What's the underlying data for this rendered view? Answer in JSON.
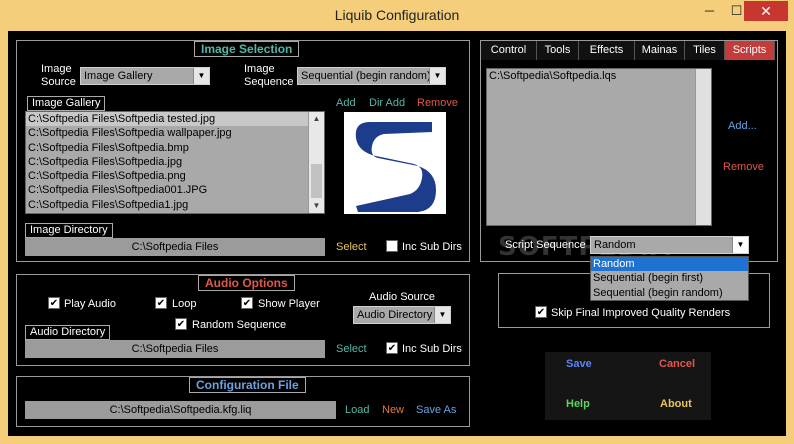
{
  "window": {
    "title": "Liquib Configuration",
    "minimize": "─",
    "maximize": "☐",
    "close": "✕"
  },
  "image_selection": {
    "legend": "Image Selection",
    "source_label_1": "Image",
    "source_label_2": "Source",
    "source_value": "Image Gallery",
    "sequence_label_1": "Image",
    "sequence_label_2": "Sequence",
    "sequence_value": "Sequential (begin random)",
    "gallery_label": "Image Gallery",
    "gallery_items": [
      "C:\\Softpedia Files\\Softpedia tested.jpg",
      "C:\\Softpedia Files\\Softpedia wallpaper.jpg",
      "C:\\Softpedia Files\\Softpedia.bmp",
      "C:\\Softpedia Files\\Softpedia.jpg",
      "C:\\Softpedia Files\\Softpedia.png",
      "C:\\Softpedia Files\\Softpedia001.JPG",
      "C:\\Softpedia Files\\Softpedia1.jpg"
    ],
    "add": "Add",
    "dir_add": "Dir Add",
    "remove": "Remove",
    "directory_label": "Image Directory",
    "directory_value": "C:\\Softpedia Files",
    "select": "Select",
    "inc_sub_dirs": "Inc Sub Dirs"
  },
  "audio_options": {
    "legend": "Audio Options",
    "play_audio": "Play Audio",
    "loop": "Loop",
    "show_player": "Show Player",
    "random_sequence": "Random Sequence",
    "audio_source_label": "Audio Source",
    "audio_source_value": "Audio Directory",
    "directory_label": "Audio Directory",
    "directory_value": "C:\\Softpedia Files",
    "select": "Select",
    "inc_sub_dirs": "Inc Sub Dirs"
  },
  "config_file": {
    "legend": "Configuration File",
    "path": "C:\\Softpedia\\Softpedia.kfg.liq",
    "load": "Load",
    "new": "New",
    "save_as": "Save As"
  },
  "tabs": [
    "Control",
    "Tools",
    "Effects",
    "Mainas",
    "Tiles",
    "Scripts"
  ],
  "scripts": {
    "items": [
      "C:\\Softpedia\\Softpedia.lqs"
    ],
    "add": "Add...",
    "remove": "Remove",
    "sequence_label": "Script Sequence",
    "sequence_value": "Random",
    "sequence_options": [
      "Random",
      "Sequential (begin first)",
      "Sequential (begin random)"
    ],
    "skip_label": "Skip Final Improved Quality Renders",
    "watermark": "SOFTPEDIA"
  },
  "buttons": {
    "save": "Save",
    "cancel": "Cancel",
    "help": "Help",
    "about": "About"
  },
  "colors": {
    "titlebar": "#f4ce7b",
    "close": "#c7372f",
    "accent_teal": "#53b7a9",
    "accent_red": "#e0584c",
    "active_tab": "#c23c3c",
    "highlight": "#1e73d2"
  },
  "icons": {
    "check": "✔",
    "dropdown": "▼",
    "scroll_up": "▲",
    "scroll_down": "▼"
  }
}
